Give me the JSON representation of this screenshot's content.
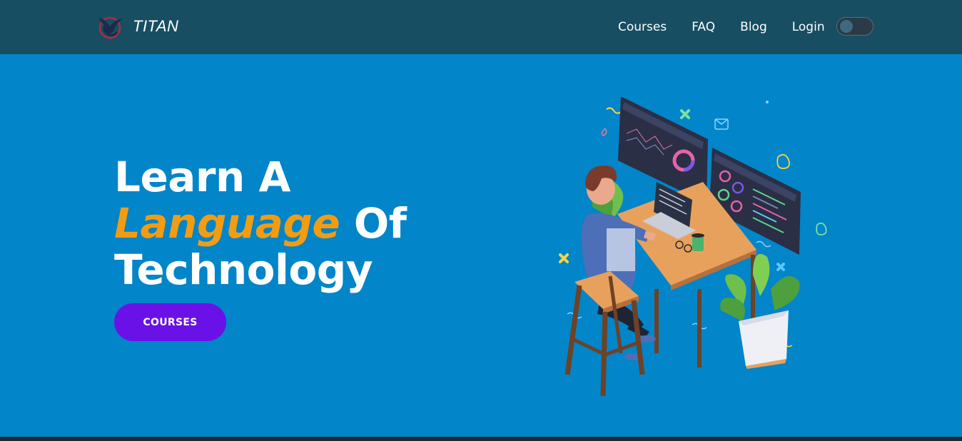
{
  "brand": {
    "name": "TITAN",
    "logo_icon": "eagle-logo-icon"
  },
  "nav": {
    "links": [
      {
        "label": "Courses"
      },
      {
        "label": "FAQ"
      },
      {
        "label": "Blog"
      },
      {
        "label": "Login"
      }
    ],
    "theme_toggle": {
      "state": "off",
      "icon": "toggle-switch-icon"
    }
  },
  "hero": {
    "line1": "Learn A",
    "line2_accent": "Language",
    "line2_rest": " Of",
    "line3": "Technology",
    "cta_label": "COURSES",
    "illustration_icon": "developer-at-desk-illustration-icon"
  },
  "colors": {
    "nav_bg": "#174e62",
    "hero_bg": "#0285c9",
    "accent": "#f39c12",
    "cta_bg": "#6a11e8",
    "text": "#ffffff"
  }
}
